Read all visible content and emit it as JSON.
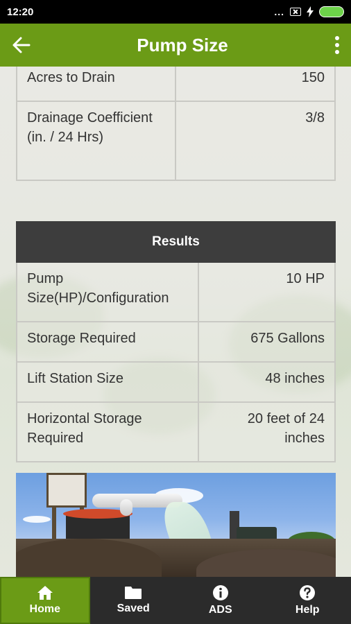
{
  "status_bar": {
    "time": "12:20",
    "dots": "..."
  },
  "app_bar": {
    "title": "Pump Size",
    "back_icon": "arrow-left-icon",
    "menu_icon": "more-vert-icon"
  },
  "inputs": {
    "rows": [
      {
        "label": "Acres to Drain",
        "value": "150"
      },
      {
        "label": "Drainage Coefficient (in. / 24 Hrs)",
        "value": "3/8"
      }
    ]
  },
  "results": {
    "header": "Results",
    "rows": [
      {
        "label": "Pump Size(HP)/Configuration",
        "value": "10 HP"
      },
      {
        "label": "Storage Required",
        "value": "675 Gallons"
      },
      {
        "label": "Lift Station Size",
        "value": "48 inches"
      },
      {
        "label": "Horizontal Storage Required",
        "value": "20 feet of 24 inches"
      }
    ]
  },
  "bottom_nav": {
    "items": [
      {
        "label": "Home",
        "icon": "home-icon",
        "active": true
      },
      {
        "label": "Saved",
        "icon": "folder-icon",
        "active": false
      },
      {
        "label": "ADS",
        "icon": "info-icon",
        "active": false
      },
      {
        "label": "Help",
        "icon": "help-icon",
        "active": false
      }
    ]
  },
  "colors": {
    "brand_green": "#6b9b16",
    "dark": "#2b2b2b",
    "results_header": "#3d3d3d"
  }
}
